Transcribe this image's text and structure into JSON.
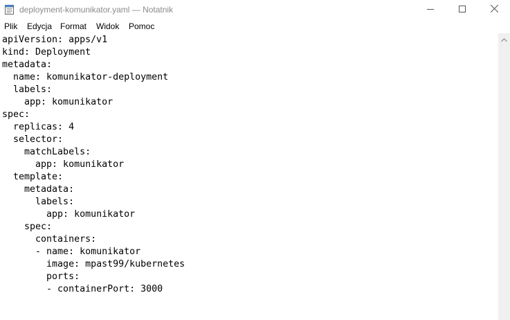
{
  "window": {
    "title": "deployment-komunikator.yaml — Notatnik"
  },
  "menu": {
    "items": [
      "Plik",
      "Edycja",
      "Format",
      "Widok",
      "Pomoc"
    ]
  },
  "editor": {
    "lines": [
      "apiVersion: apps/v1",
      "kind: Deployment",
      "metadata:",
      "  name: komunikator-deployment",
      "  labels:",
      "    app: komunikator",
      "spec:",
      "  replicas: 4",
      "  selector:",
      "    matchLabels:",
      "      app: komunikator",
      "  template:",
      "    metadata:",
      "      labels:",
      "        app: komunikator",
      "    spec:",
      "      containers:",
      "      - name: komunikator",
      "        image: mpast99/kubernetes",
      "        ports:",
      "        - containerPort: 3000"
    ]
  },
  "icons": {
    "app": "notepad-icon",
    "minimize": "minimize-icon",
    "maximize": "maximize-icon",
    "close": "close-icon",
    "scroll_up": "scroll-up-arrow-icon"
  }
}
